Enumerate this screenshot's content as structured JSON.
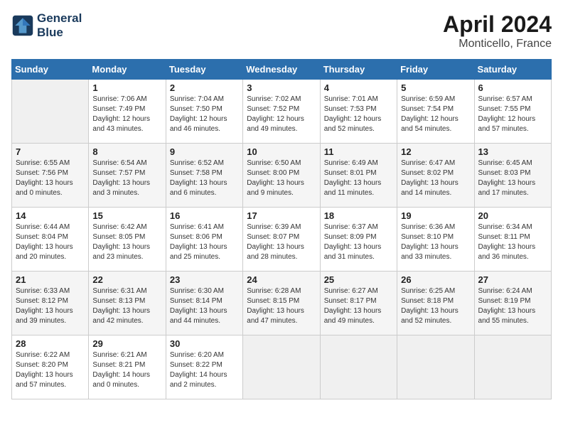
{
  "header": {
    "logo_line1": "General",
    "logo_line2": "Blue",
    "month": "April 2024",
    "location": "Monticello, France"
  },
  "columns": [
    "Sunday",
    "Monday",
    "Tuesday",
    "Wednesday",
    "Thursday",
    "Friday",
    "Saturday"
  ],
  "weeks": [
    [
      {
        "day": "",
        "sunrise": "",
        "sunset": "",
        "daylight": ""
      },
      {
        "day": "1",
        "sunrise": "Sunrise: 7:06 AM",
        "sunset": "Sunset: 7:49 PM",
        "daylight": "Daylight: 12 hours and 43 minutes."
      },
      {
        "day": "2",
        "sunrise": "Sunrise: 7:04 AM",
        "sunset": "Sunset: 7:50 PM",
        "daylight": "Daylight: 12 hours and 46 minutes."
      },
      {
        "day": "3",
        "sunrise": "Sunrise: 7:02 AM",
        "sunset": "Sunset: 7:52 PM",
        "daylight": "Daylight: 12 hours and 49 minutes."
      },
      {
        "day": "4",
        "sunrise": "Sunrise: 7:01 AM",
        "sunset": "Sunset: 7:53 PM",
        "daylight": "Daylight: 12 hours and 52 minutes."
      },
      {
        "day": "5",
        "sunrise": "Sunrise: 6:59 AM",
        "sunset": "Sunset: 7:54 PM",
        "daylight": "Daylight: 12 hours and 54 minutes."
      },
      {
        "day": "6",
        "sunrise": "Sunrise: 6:57 AM",
        "sunset": "Sunset: 7:55 PM",
        "daylight": "Daylight: 12 hours and 57 minutes."
      }
    ],
    [
      {
        "day": "7",
        "sunrise": "Sunrise: 6:55 AM",
        "sunset": "Sunset: 7:56 PM",
        "daylight": "Daylight: 13 hours and 0 minutes."
      },
      {
        "day": "8",
        "sunrise": "Sunrise: 6:54 AM",
        "sunset": "Sunset: 7:57 PM",
        "daylight": "Daylight: 13 hours and 3 minutes."
      },
      {
        "day": "9",
        "sunrise": "Sunrise: 6:52 AM",
        "sunset": "Sunset: 7:58 PM",
        "daylight": "Daylight: 13 hours and 6 minutes."
      },
      {
        "day": "10",
        "sunrise": "Sunrise: 6:50 AM",
        "sunset": "Sunset: 8:00 PM",
        "daylight": "Daylight: 13 hours and 9 minutes."
      },
      {
        "day": "11",
        "sunrise": "Sunrise: 6:49 AM",
        "sunset": "Sunset: 8:01 PM",
        "daylight": "Daylight: 13 hours and 11 minutes."
      },
      {
        "day": "12",
        "sunrise": "Sunrise: 6:47 AM",
        "sunset": "Sunset: 8:02 PM",
        "daylight": "Daylight: 13 hours and 14 minutes."
      },
      {
        "day": "13",
        "sunrise": "Sunrise: 6:45 AM",
        "sunset": "Sunset: 8:03 PM",
        "daylight": "Daylight: 13 hours and 17 minutes."
      }
    ],
    [
      {
        "day": "14",
        "sunrise": "Sunrise: 6:44 AM",
        "sunset": "Sunset: 8:04 PM",
        "daylight": "Daylight: 13 hours and 20 minutes."
      },
      {
        "day": "15",
        "sunrise": "Sunrise: 6:42 AM",
        "sunset": "Sunset: 8:05 PM",
        "daylight": "Daylight: 13 hours and 23 minutes."
      },
      {
        "day": "16",
        "sunrise": "Sunrise: 6:41 AM",
        "sunset": "Sunset: 8:06 PM",
        "daylight": "Daylight: 13 hours and 25 minutes."
      },
      {
        "day": "17",
        "sunrise": "Sunrise: 6:39 AM",
        "sunset": "Sunset: 8:07 PM",
        "daylight": "Daylight: 13 hours and 28 minutes."
      },
      {
        "day": "18",
        "sunrise": "Sunrise: 6:37 AM",
        "sunset": "Sunset: 8:09 PM",
        "daylight": "Daylight: 13 hours and 31 minutes."
      },
      {
        "day": "19",
        "sunrise": "Sunrise: 6:36 AM",
        "sunset": "Sunset: 8:10 PM",
        "daylight": "Daylight: 13 hours and 33 minutes."
      },
      {
        "day": "20",
        "sunrise": "Sunrise: 6:34 AM",
        "sunset": "Sunset: 8:11 PM",
        "daylight": "Daylight: 13 hours and 36 minutes."
      }
    ],
    [
      {
        "day": "21",
        "sunrise": "Sunrise: 6:33 AM",
        "sunset": "Sunset: 8:12 PM",
        "daylight": "Daylight: 13 hours and 39 minutes."
      },
      {
        "day": "22",
        "sunrise": "Sunrise: 6:31 AM",
        "sunset": "Sunset: 8:13 PM",
        "daylight": "Daylight: 13 hours and 42 minutes."
      },
      {
        "day": "23",
        "sunrise": "Sunrise: 6:30 AM",
        "sunset": "Sunset: 8:14 PM",
        "daylight": "Daylight: 13 hours and 44 minutes."
      },
      {
        "day": "24",
        "sunrise": "Sunrise: 6:28 AM",
        "sunset": "Sunset: 8:15 PM",
        "daylight": "Daylight: 13 hours and 47 minutes."
      },
      {
        "day": "25",
        "sunrise": "Sunrise: 6:27 AM",
        "sunset": "Sunset: 8:17 PM",
        "daylight": "Daylight: 13 hours and 49 minutes."
      },
      {
        "day": "26",
        "sunrise": "Sunrise: 6:25 AM",
        "sunset": "Sunset: 8:18 PM",
        "daylight": "Daylight: 13 hours and 52 minutes."
      },
      {
        "day": "27",
        "sunrise": "Sunrise: 6:24 AM",
        "sunset": "Sunset: 8:19 PM",
        "daylight": "Daylight: 13 hours and 55 minutes."
      }
    ],
    [
      {
        "day": "28",
        "sunrise": "Sunrise: 6:22 AM",
        "sunset": "Sunset: 8:20 PM",
        "daylight": "Daylight: 13 hours and 57 minutes."
      },
      {
        "day": "29",
        "sunrise": "Sunrise: 6:21 AM",
        "sunset": "Sunset: 8:21 PM",
        "daylight": "Daylight: 14 hours and 0 minutes."
      },
      {
        "day": "30",
        "sunrise": "Sunrise: 6:20 AM",
        "sunset": "Sunset: 8:22 PM",
        "daylight": "Daylight: 14 hours and 2 minutes."
      },
      {
        "day": "",
        "sunrise": "",
        "sunset": "",
        "daylight": ""
      },
      {
        "day": "",
        "sunrise": "",
        "sunset": "",
        "daylight": ""
      },
      {
        "day": "",
        "sunrise": "",
        "sunset": "",
        "daylight": ""
      },
      {
        "day": "",
        "sunrise": "",
        "sunset": "",
        "daylight": ""
      }
    ]
  ]
}
